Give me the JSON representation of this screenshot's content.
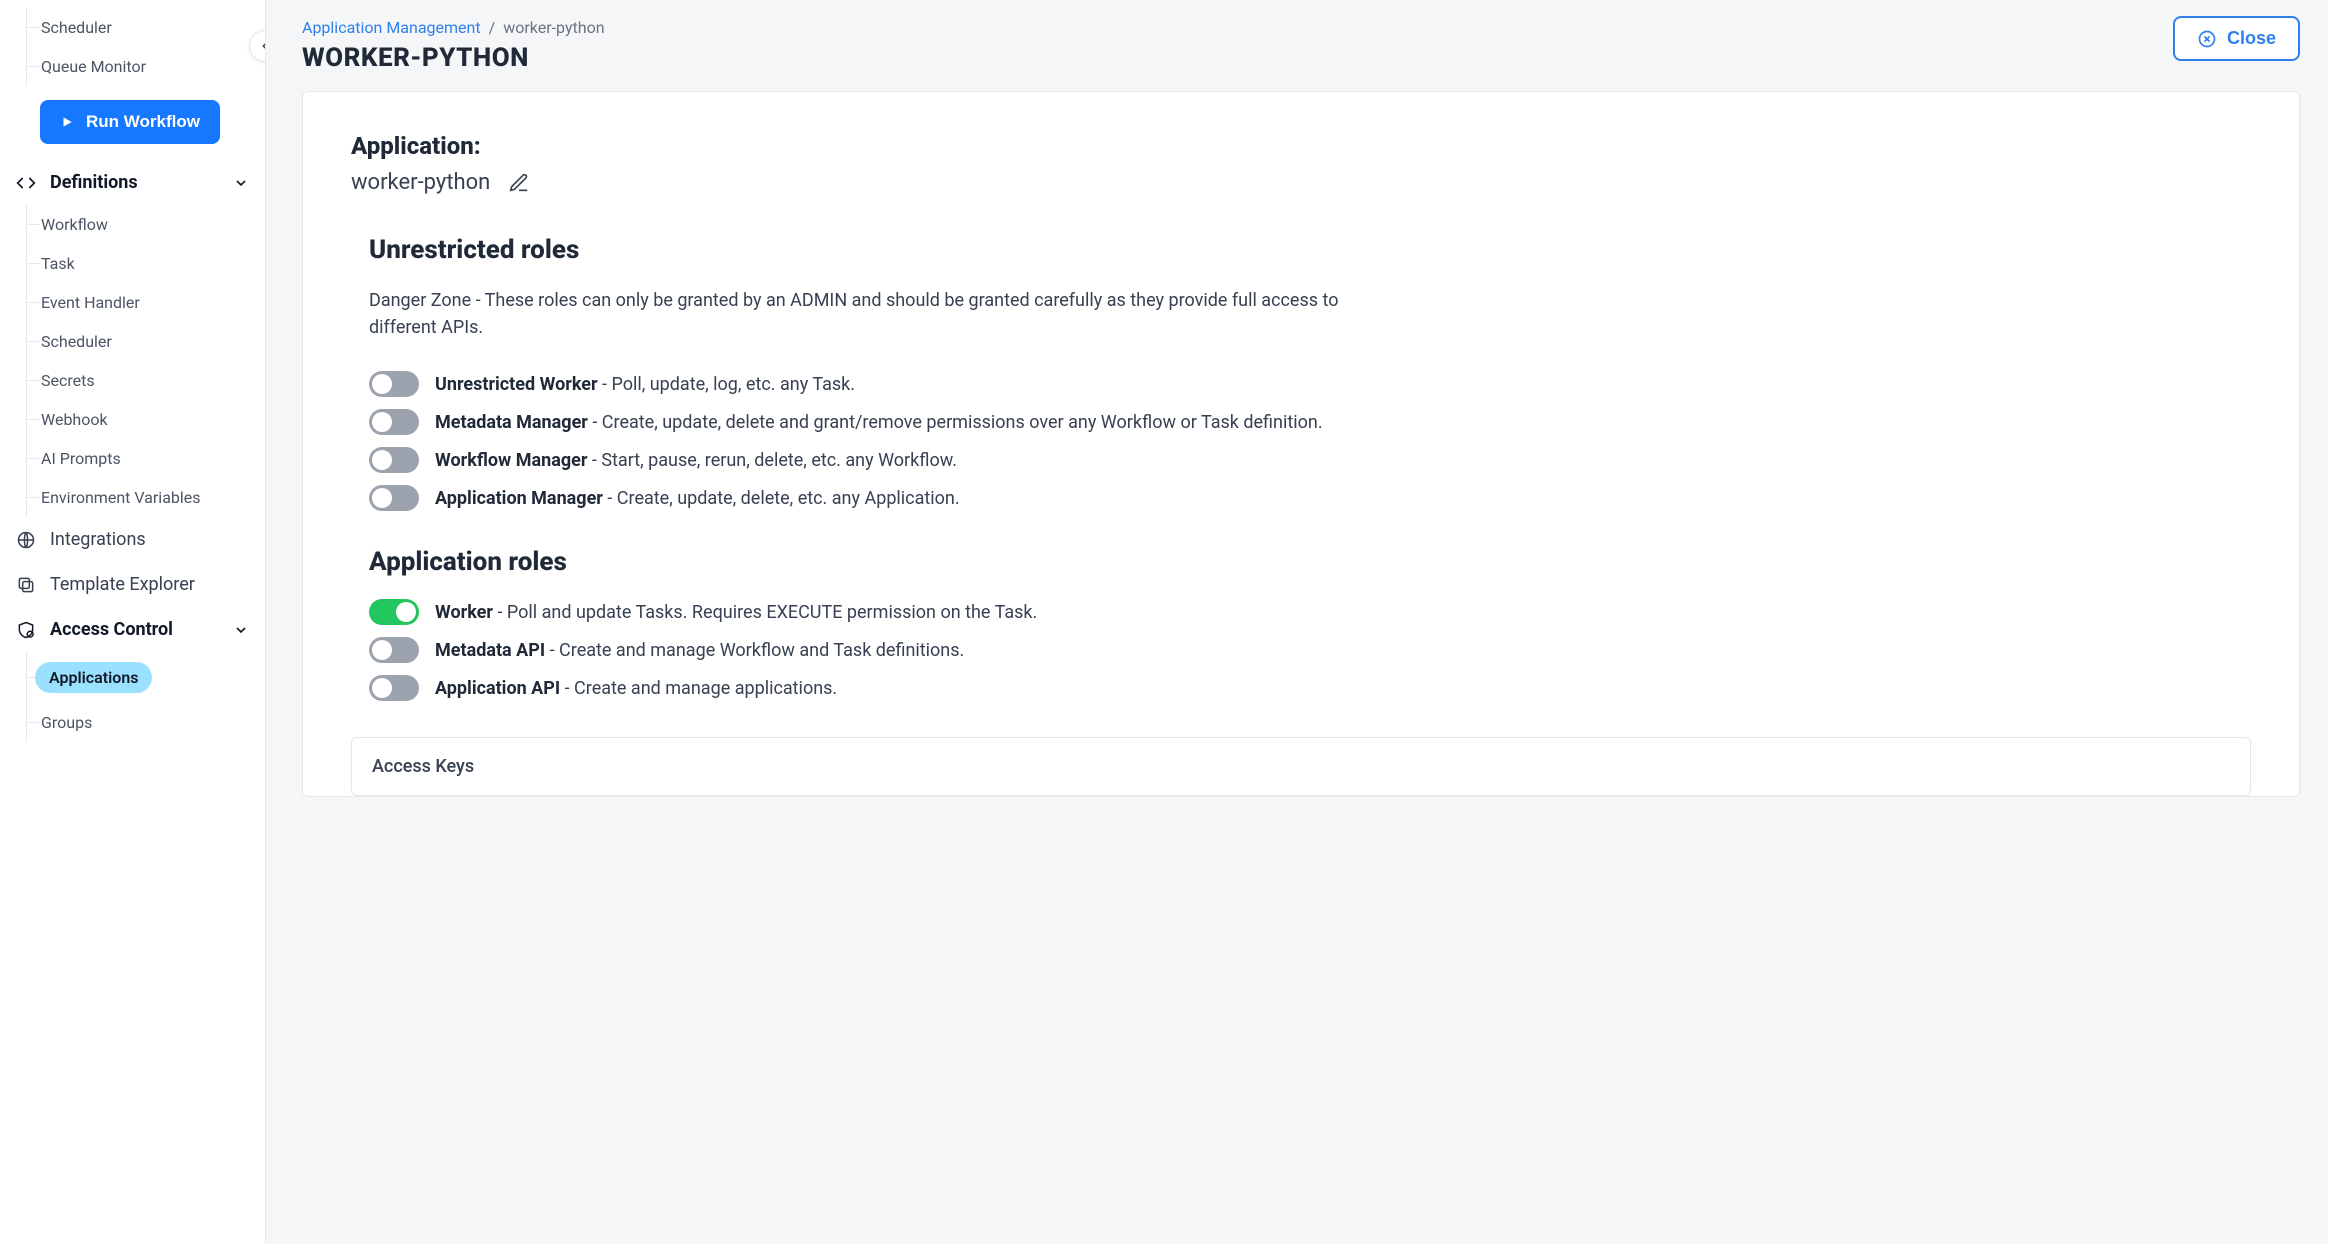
{
  "sidebar": {
    "top_items": [
      "Scheduler",
      "Queue Monitor"
    ],
    "run_workflow_label": "Run Workflow",
    "definitions": {
      "label": "Definitions",
      "items": [
        "Workflow",
        "Task",
        "Event Handler",
        "Scheduler",
        "Secrets",
        "Webhook",
        "AI Prompts",
        "Environment Variables"
      ]
    },
    "integrations_label": "Integrations",
    "template_explorer_label": "Template Explorer",
    "access_control": {
      "label": "Access Control",
      "items": [
        "Applications",
        "Groups"
      ],
      "active_index": 0
    }
  },
  "breadcrumb": {
    "parent": "Application Management",
    "current": "worker-python"
  },
  "page_title": "WORKER-PYTHON",
  "close_label": "Close",
  "application": {
    "label": "Application:",
    "name": "worker-python"
  },
  "unrestricted": {
    "heading": "Unrestricted roles",
    "danger_text": "Danger Zone - These roles can only be granted by an ADMIN and should be granted carefully as they provide full access to different APIs.",
    "roles": [
      {
        "name": "Unrestricted Worker",
        "desc": " - Poll, update, log, etc. any Task.",
        "on": false
      },
      {
        "name": "Metadata Manager",
        "desc": " - Create, update, delete and grant/remove permissions over any Workflow or Task definition.",
        "on": false
      },
      {
        "name": "Workflow Manager",
        "desc": " - Start, pause, rerun, delete, etc. any Workflow.",
        "on": false
      },
      {
        "name": "Application Manager",
        "desc": " - Create, update, delete, etc. any Application.",
        "on": false
      }
    ]
  },
  "app_roles": {
    "heading": "Application roles",
    "roles": [
      {
        "name": "Worker",
        "desc": " - Poll and update Tasks. Requires EXECUTE permission on the Task.",
        "on": true
      },
      {
        "name": "Metadata API",
        "desc": " - Create and manage Workflow and Task definitions.",
        "on": false
      },
      {
        "name": "Application API",
        "desc": " - Create and manage applications.",
        "on": false
      }
    ]
  },
  "access_keys_label": "Access Keys"
}
